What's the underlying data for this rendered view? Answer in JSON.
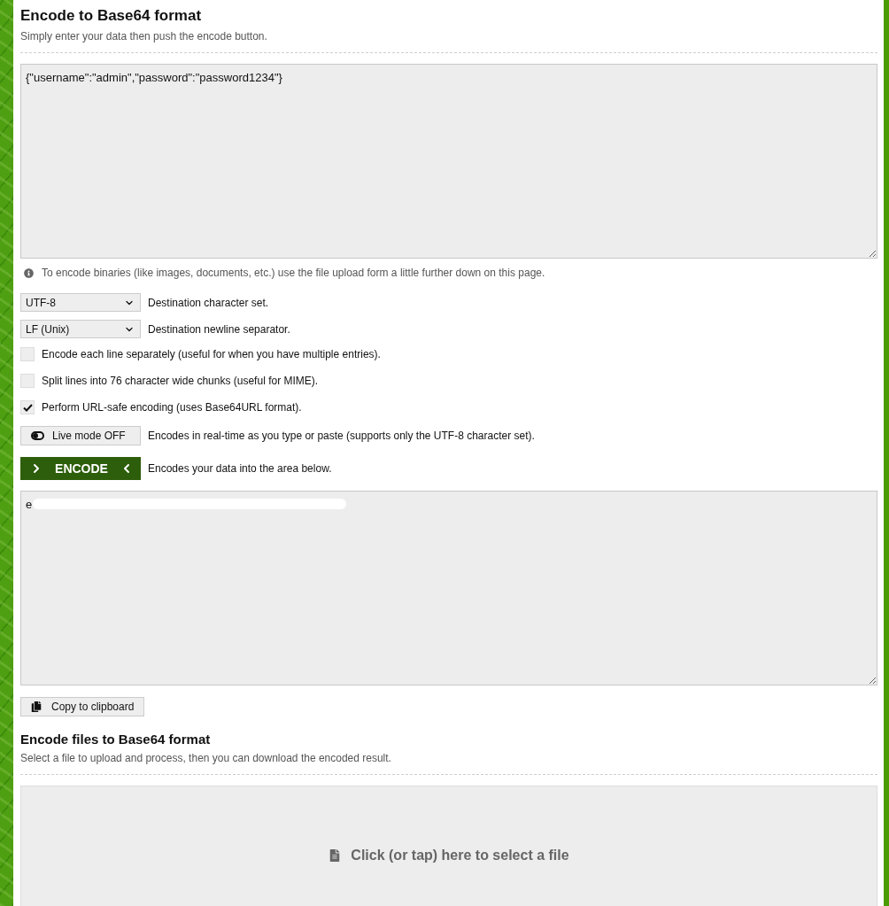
{
  "encode_section": {
    "title": "Encode to Base64 format",
    "subtitle": "Simply enter your data then push the encode button."
  },
  "input": {
    "value": "{\"username\":\"admin\",\"password\":\"password1234\"}"
  },
  "info_note": "To encode binaries (like images, documents, etc.) use the file upload form a little further down on this page.",
  "selects": [
    {
      "value": "UTF-8",
      "label": "Destination character set."
    },
    {
      "value": "LF (Unix)",
      "label": "Destination newline separator."
    }
  ],
  "options": [
    {
      "label": "Encode each line separately (useful for when you have multiple entries).",
      "checked": false
    },
    {
      "label": "Split lines into 76 character wide chunks (useful for MIME).",
      "checked": false
    },
    {
      "label": "Perform URL-safe encoding (uses Base64URL format).",
      "checked": true
    }
  ],
  "live_mode": {
    "button": "Live mode OFF",
    "description": "Encodes in real-time as you type or paste (supports only the UTF-8 character set)."
  },
  "encode": {
    "button": "ENCODE",
    "description": "Encodes your data into the area below."
  },
  "output": {
    "value": "e",
    "redacted": true
  },
  "copy_button": "Copy to clipboard",
  "file_section": {
    "title": "Encode files to Base64 format",
    "subtitle": "Select a file to upload and process, then you can download the encoded result.",
    "drop_zone": "Click (or tap) here to select a file"
  }
}
